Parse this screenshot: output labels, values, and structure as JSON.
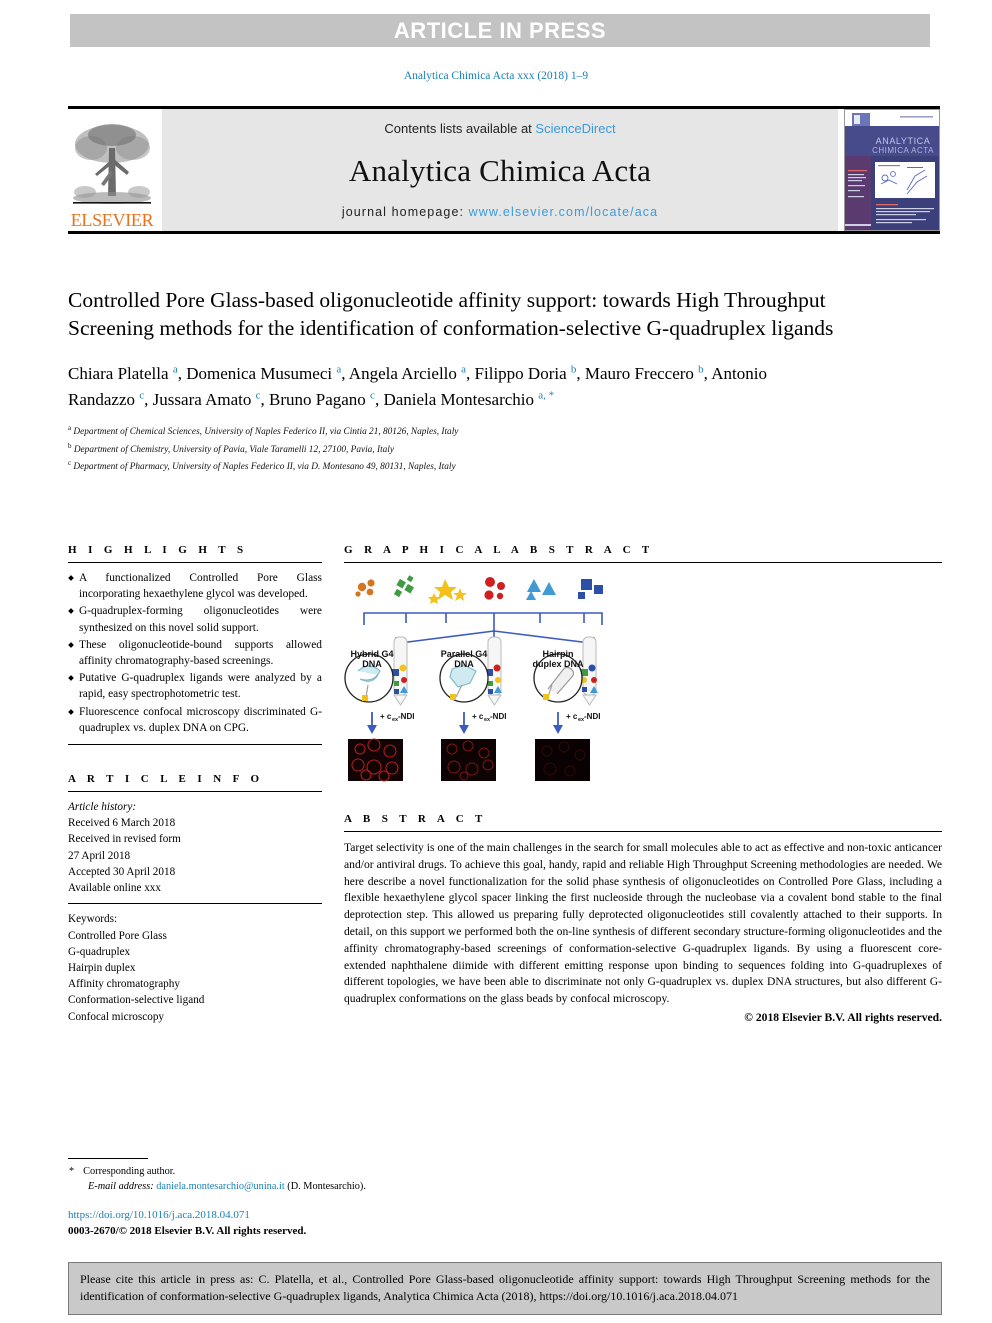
{
  "banner": {
    "text": "ARTICLE IN PRESS"
  },
  "running_head": {
    "text": "Analytica Chimica Acta xxx (2018) 1–9"
  },
  "masthead": {
    "contents_prefix": "Contents lists available at ",
    "sciencedirect": "ScienceDirect",
    "journal_title": "Analytica Chimica Acta",
    "homepage_prefix": "journal homepage: ",
    "homepage_url": "www.elsevier.com/locate/aca",
    "publisher": "ELSEVIER",
    "cover_title_line1": "ANALYTICA",
    "cover_title_line2": "CHIMICA ACTA"
  },
  "article": {
    "title": "Controlled Pore Glass-based oligonucleotide affinity support: towards High Throughput Screening methods for the identification of conformation-selective G-quadruplex ligands",
    "authors": [
      {
        "name": "Chiara Platella",
        "sup": "a",
        "sep": ", "
      },
      {
        "name": "Domenica Musumeci",
        "sup": "a",
        "sep": ", "
      },
      {
        "name": "Angela Arciello",
        "sup": "a",
        "sep": ", "
      },
      {
        "name": "Filippo Doria",
        "sup": "b",
        "sep": ", "
      },
      {
        "name": "Mauro Freccero",
        "sup": "b",
        "sep": ", "
      },
      {
        "name": "Antonio Randazzo",
        "sup": "c",
        "sep": ", "
      },
      {
        "name": "Jussara Amato",
        "sup": "c",
        "sep": ", "
      },
      {
        "name": "Bruno Pagano",
        "sup": "c",
        "sep": ", "
      },
      {
        "name": "Daniela Montesarchio",
        "sup": "a, *",
        "sep": ""
      }
    ],
    "affiliations": [
      {
        "marker": "a",
        "text": "Department of Chemical Sciences, University of Naples Federico II, via Cintia 21, 80126, Naples, Italy"
      },
      {
        "marker": "b",
        "text": "Department of Chemistry, University of Pavia, Viale Taramelli 12, 27100, Pavia, Italy"
      },
      {
        "marker": "c",
        "text": "Department of Pharmacy, University of Naples Federico II, via D. Montesano 49, 80131, Naples, Italy"
      }
    ]
  },
  "highlights": {
    "heading": "H I G H L I G H T S",
    "items": [
      "A functionalized Controlled Pore Glass incorporating hexaethylene glycol was developed.",
      "G-quadruplex-forming oligonucleotides were synthesized on this novel solid support.",
      "These oligonucleotide-bound supports allowed affinity chromatography-based screenings.",
      "Putative G-quadruplex ligands were analyzed by a rapid, easy spectrophotometric test.",
      "Fluorescence confocal microscopy discriminated G-quadruplex vs. duplex DNA on CPG."
    ]
  },
  "graphical_abstract": {
    "heading": "G R A P H I C A L   A B S T R A C T",
    "columns": [
      {
        "label_line1": "Hybrid G4",
        "label_line2": "DNA",
        "arrow_label": "+ cₑₓ-NDI"
      },
      {
        "label_line1": "Parallel G4",
        "label_line2": "DNA",
        "arrow_label": "+ cₑₓ-NDI"
      },
      {
        "label_line1": "Hairpin",
        "label_line2": "duplex DNA",
        "arrow_label": "+ cₑₓ-NDI"
      }
    ],
    "ligand_colors": [
      "#d4761f",
      "#3f9b3f",
      "#f2c21b",
      "#cf2020",
      "#3f9bd4",
      "#2c4fa8"
    ]
  },
  "article_info": {
    "heading": "A R T I C L E   I N F O",
    "history_label": "Article history:",
    "history": [
      "Received 6 March 2018",
      "Received in revised form",
      "27 April 2018",
      "Accepted 30 April 2018",
      "Available online xxx"
    ],
    "keywords_label": "Keywords:",
    "keywords": [
      "Controlled Pore Glass",
      "G-quadruplex",
      "Hairpin duplex",
      "Affinity chromatography",
      "Conformation-selective ligand",
      "Confocal microscopy"
    ]
  },
  "abstract": {
    "heading": "A B S T R A C T",
    "text": "Target selectivity is one of the main challenges in the search for small molecules able to act as effective and non-toxic anticancer and/or antiviral drugs. To achieve this goal, handy, rapid and reliable High Throughput Screening methodologies are needed. We here describe a novel functionalization for the solid phase synthesis of oligonucleotides on Controlled Pore Glass, including a flexible hexaethylene glycol spacer linking the first nucleoside through the nucleobase via a covalent bond stable to the final deprotection step. This allowed us preparing fully deprotected oligonucleotides still covalently attached to their supports. In detail, on this support we performed both the on-line synthesis of different secondary structure-forming oligonucleotides and the affinity chromatography-based screenings of conformation-selective G-quadruplex ligands. By using a fluorescent core-extended naphthalene diimide with different emitting response upon binding to sequences folding into G-quadruplexes of different topologies, we have been able to discriminate not only G-quadruplex vs. duplex DNA structures, but also different G-quadruplex conformations on the glass beads by confocal microscopy.",
    "copyright": "© 2018 Elsevier B.V. All rights reserved."
  },
  "footnotes": {
    "corresponding": "Corresponding author.",
    "email_label": "E-mail address:",
    "email": "daniela.montesarchio@unina.it",
    "email_suffix": "(D. Montesarchio)."
  },
  "doi_block": {
    "doi_url": "https://doi.org/10.1016/j.aca.2018.04.071",
    "issn_line": "0003-2670/© 2018 Elsevier B.V. All rights reserved."
  },
  "cite_box": {
    "text": "Please cite this article in press as: C. Platella, et al., Controlled Pore Glass-based oligonucleotide affinity support: towards High Throughput Screening methods for the identification of conformation-selective G-quadruplex ligands, Analytica Chimica Acta (2018), https://doi.org/10.1016/j.aca.2018.04.071"
  },
  "colors": {
    "link": "#1a7fb5",
    "sciencedirect": "#3b9ad9",
    "elsevier_orange": "#E9711C",
    "banner_grey": "#c3c3c3",
    "masthead_grey": "#e6e6e6",
    "cite_grey": "#c9c9c9"
  }
}
